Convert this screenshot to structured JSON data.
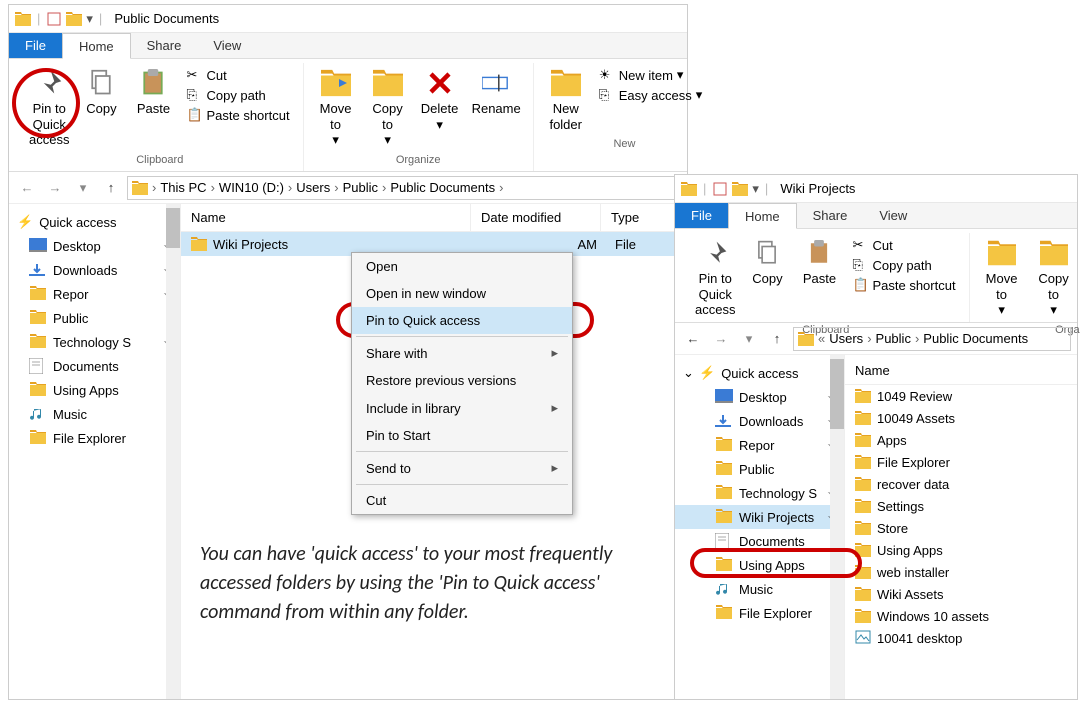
{
  "win1": {
    "title": "Public Documents",
    "menu": {
      "file": "File",
      "home": "Home",
      "share": "Share",
      "view": "View"
    },
    "ribbon": {
      "pin": "Pin to Quick\naccess",
      "copy": "Copy",
      "paste": "Paste",
      "cut": "Cut",
      "copypath": "Copy path",
      "pasteshort": "Paste shortcut",
      "clipboard": "Clipboard",
      "moveto": "Move\nto",
      "copyto": "Copy\nto",
      "delete": "Delete",
      "rename": "Rename",
      "organize": "Organize",
      "newfolder": "New\nfolder",
      "newitem": "New item",
      "easy": "Easy access",
      "new": "New"
    },
    "breadcrumbs": [
      "This PC",
      "WIN10 (D:)",
      "Users",
      "Public",
      "Public Documents"
    ],
    "cols": {
      "name": "Name",
      "date": "Date modified",
      "type": "Type"
    },
    "qa_label": "Quick access",
    "side": [
      {
        "label": "Desktop",
        "pinned": true,
        "icon": "desktop"
      },
      {
        "label": "Downloads",
        "pinned": true,
        "icon": "downloads"
      },
      {
        "label": "Repor",
        "pinned": true,
        "icon": "folder"
      },
      {
        "label": "Public",
        "pinned": false,
        "icon": "folder"
      },
      {
        "label": "Technology S",
        "pinned": true,
        "icon": "folder"
      },
      {
        "label": "Documents",
        "pinned": false,
        "icon": "docs"
      },
      {
        "label": "Using Apps",
        "pinned": false,
        "icon": "folder"
      },
      {
        "label": "Music",
        "pinned": false,
        "icon": "music"
      },
      {
        "label": "File Explorer",
        "pinned": false,
        "icon": "folder"
      }
    ],
    "file": {
      "name": "Wiki Projects",
      "date": "AM",
      "type": "File"
    },
    "ctx": [
      "Open",
      "Open in new window",
      "Pin to Quick access",
      "Share with",
      "Restore previous versions",
      "Include in library",
      "Pin to Start",
      "Send to",
      "Cut"
    ]
  },
  "win2": {
    "title": "Wiki Projects",
    "menu": {
      "file": "File",
      "home": "Home",
      "share": "Share",
      "view": "View"
    },
    "ribbon": {
      "pin": "Pin to Quick\naccess",
      "copy": "Copy",
      "paste": "Paste",
      "cut": "Cut",
      "copypath": "Copy path",
      "pasteshort": "Paste shortcut",
      "clipboard": "Clipboard",
      "moveto": "Move\nto",
      "copyto": "Copy\nto",
      "organize": "Orga"
    },
    "breadcrumbs": [
      "Users",
      "Public",
      "Public Documents"
    ],
    "qa_label": "Quick access",
    "side": [
      {
        "label": "Desktop",
        "pinned": true,
        "icon": "desktop"
      },
      {
        "label": "Downloads",
        "pinned": true,
        "icon": "downloads"
      },
      {
        "label": "Repor",
        "pinned": true,
        "icon": "folder"
      },
      {
        "label": "Public",
        "pinned": false,
        "icon": "folder"
      },
      {
        "label": "Technology S",
        "pinned": true,
        "icon": "folder"
      },
      {
        "label": "Wiki Projects",
        "pinned": true,
        "icon": "folder",
        "hi": true
      },
      {
        "label": "Documents",
        "pinned": false,
        "icon": "docs"
      },
      {
        "label": "Using Apps",
        "pinned": false,
        "icon": "folder"
      },
      {
        "label": "Music",
        "pinned": false,
        "icon": "music"
      },
      {
        "label": "File Explorer",
        "pinned": false,
        "icon": "folder"
      }
    ],
    "col": "Name",
    "files": [
      "1049 Review",
      "10049 Assets",
      "Apps",
      "File Explorer",
      "recover data",
      "Settings",
      "Store",
      "Using Apps",
      "web installer",
      "Wiki Assets",
      "Windows 10 assets"
    ],
    "imgfile": "10041 desktop"
  },
  "caption": "You can have 'quick access' to your most frequently accessed folders by using the 'Pin to Quick access' command from within any folder."
}
